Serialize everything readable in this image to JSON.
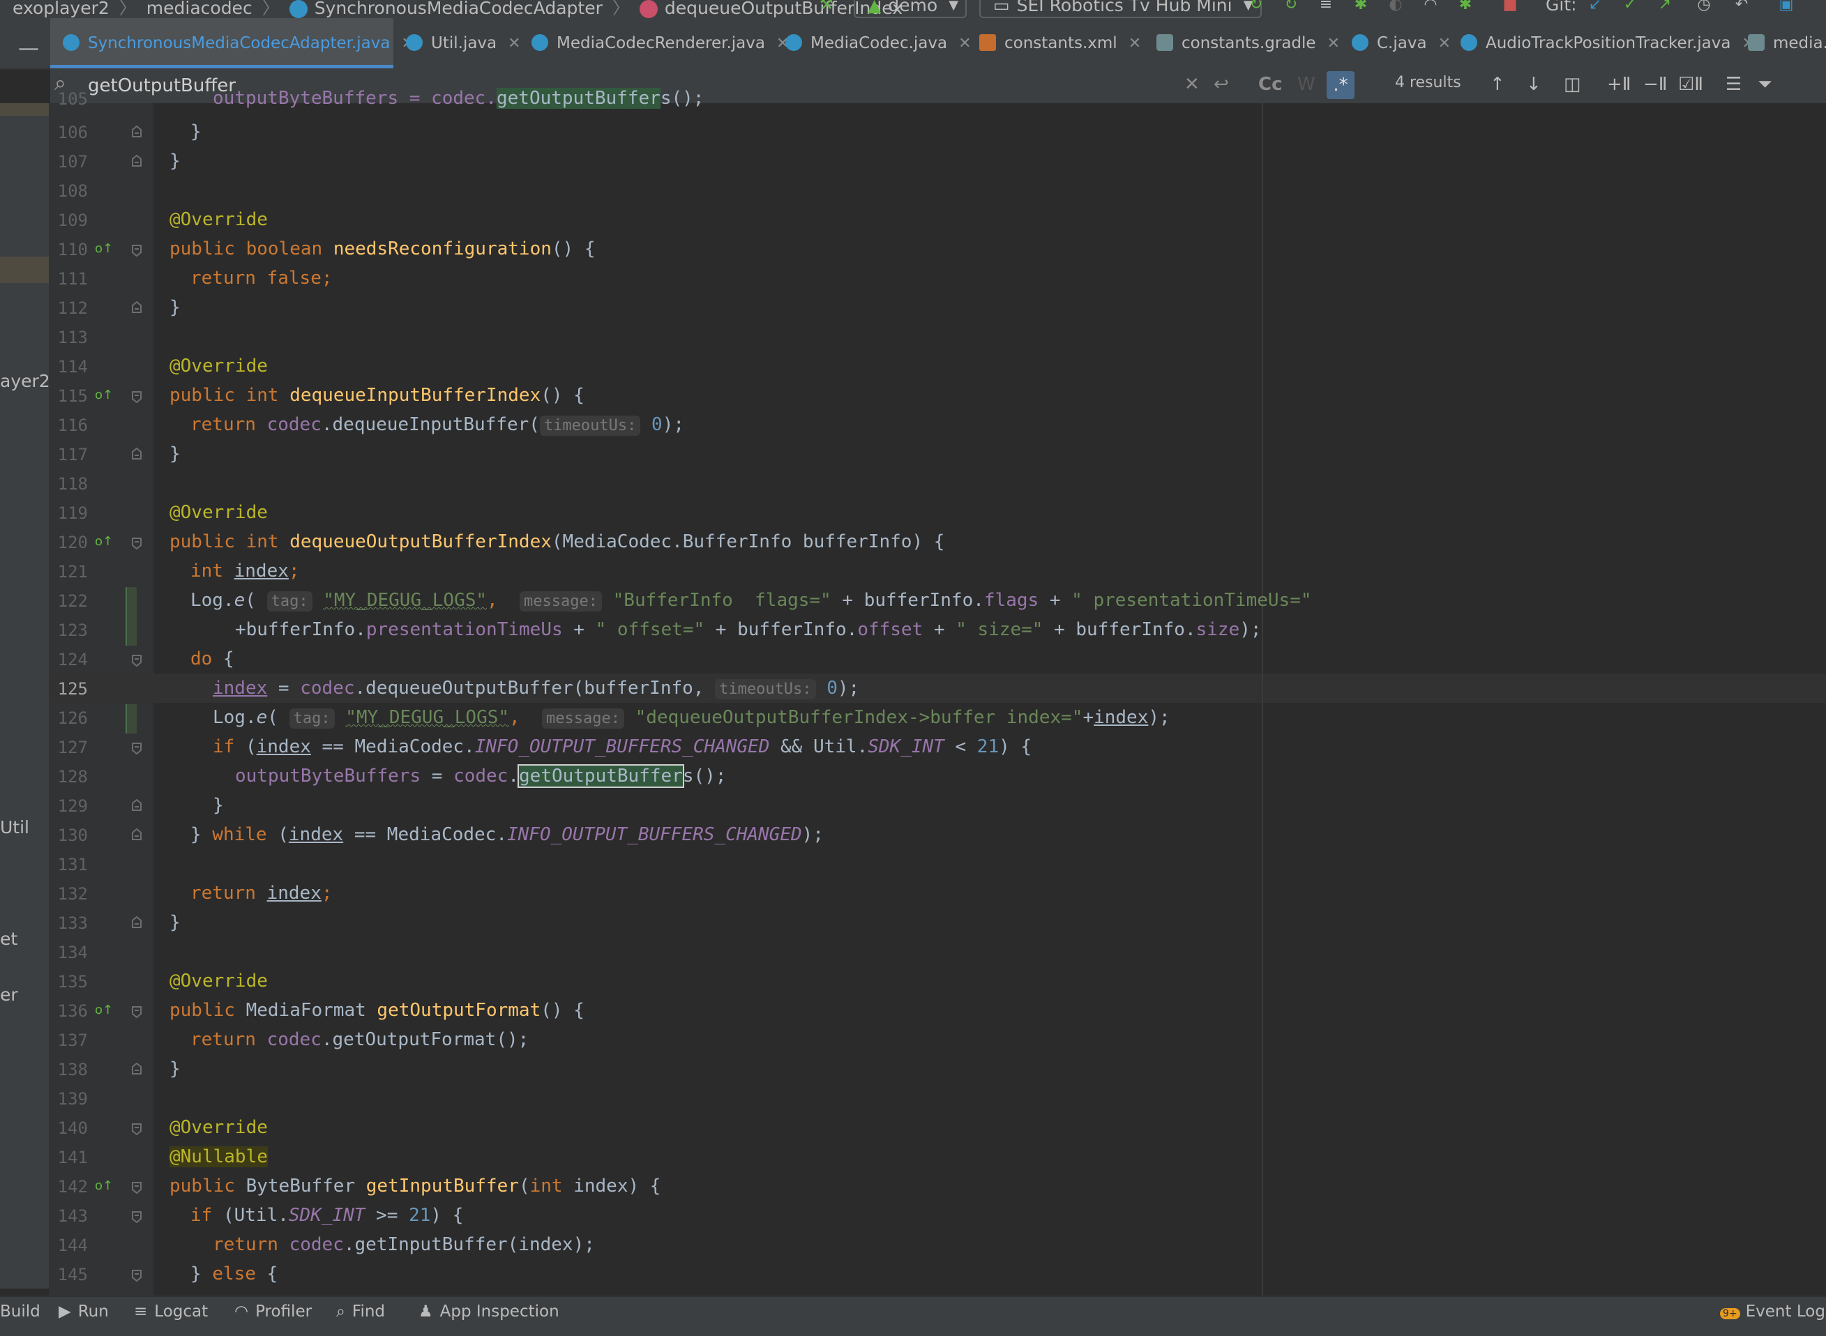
{
  "breadcrumbs": {
    "items": [
      "exoplayer2",
      "mediacodec",
      "SynchronousMediaCodecAdapter",
      "dequeueOutputBufferIndex"
    ],
    "separator": "〉"
  },
  "run_config": {
    "config": "demo",
    "device": "SEI Robotics Tv Hub Mini",
    "git_label": "Git:"
  },
  "tabs": [
    {
      "label": "SynchronousMediaCodecAdapter.java",
      "active": true
    },
    {
      "label": "Util.java"
    },
    {
      "label": "MediaCodecRenderer.java"
    },
    {
      "label": "MediaCodec.java"
    },
    {
      "label": "constants.xml"
    },
    {
      "label": "constants.gradle"
    },
    {
      "label": "C.java"
    },
    {
      "label": "AudioTrackPositionTracker.java"
    },
    {
      "label": "media.exo"
    }
  ],
  "search": {
    "value": "getOutputBuffer",
    "results": "4 results",
    "case_label": "Cc",
    "word_label": "W",
    "regex_label": ".*"
  },
  "project_strip": {
    "labels": [
      "ayer2",
      "Util",
      "et",
      "er"
    ]
  },
  "code": {
    "lines": {
      "l105": "105",
      "l106": "106",
      "l107": "107",
      "l108": "108",
      "l109": "109",
      "l110": "110",
      "l111": "111",
      "l112": "112",
      "l113": "113",
      "l114": "114",
      "l115": "115",
      "l116": "116",
      "l117": "117",
      "l118": "118",
      "l119": "119",
      "l120": "120",
      "l121": "121",
      "l122": "122",
      "l123": "123",
      "l124": "124",
      "l125": "125",
      "l126": "126",
      "l127": "127",
      "l128": "128",
      "l129": "129",
      "l130": "130",
      "l131": "131",
      "l132": "132",
      "l133": "133",
      "l134": "134",
      "l135": "135",
      "l136": "136",
      "l137": "137",
      "l138": "138",
      "l139": "139",
      "l140": "140",
      "l141": "141",
      "l142": "142",
      "l143": "143",
      "l144": "144",
      "l145": "145"
    },
    "text": {
      "override": "@Override",
      "nullable": "@Nullable",
      "public": "public",
      "int": "int",
      "boolean": "boolean",
      "return": "return",
      "false": "false",
      "if": "if",
      "do": "do",
      "while": "while",
      "else": "else",
      "codec": "codec",
      "index": "index",
      "zero": "0",
      "twentyone": "21",
      "outputByteBuffers": "outputByteBuffers",
      "bufferInfo": "bufferInfo",
      "flags": "flags",
      "presentationTimeUs": "presentationTimeUs",
      "offset": "offset",
      "size": "size",
      "INFO_OUTPUT_BUFFERS_CHANGED": "INFO_OUTPUT_BUFFERS_CHANGED",
      "SDK_INT": "SDK_INT",
      "e": "e",
      "hint_timeoutUs": "timeoutUs:",
      "hint_tag": "tag:",
      "hint_message": "message:",
      "getOutputBuffer": "getOutputBuffer",
      "l105_a": "outputByteBuffers = codec.",
      "l105_c": "s();",
      "l106": "}",
      "l107": "}",
      "l110_name": "needsReconfiguration",
      "l110_tail": "() {",
      "l111_tail": ";",
      "l112": "}",
      "l115_name": "dequeueInputBufferIndex",
      "l115_tail": "() {",
      "l116_call": ".dequeueInputBuffer(",
      "l116_tail": ");",
      "l117": "}",
      "l120_name": "dequeueOutputBufferIndex",
      "l120_tail": "(MediaCodec.BufferInfo bufferInfo) {",
      "l121_tail": ";",
      "l122_log": "Log.",
      "l122_paren": "( ",
      "l122_tagstr": "\"MY_DEGUG_LOGS\"",
      "l122_comma": ", ",
      "l122_msg": "\"BufferInfo  flags=\"",
      "l122_plus": " + ",
      "l122_dot": ".",
      "l122_str2": "\" presentationTimeUs=\"",
      "l123_plus": "+",
      "l123_str1": "\" offset=\"",
      "l123_str2": "\" size=\"",
      "l123_tail": ");",
      "l124_tail": " {",
      "l125_eq": " = ",
      "l125_call": ".dequeueOutputBuffer(bufferInfo, ",
      "l125_tail": ");",
      "l126_str": "\"dequeueOutputBufferIndex->buffer index=\"",
      "l126_plus": "+",
      "l126_tail": ");",
      "l127_open": " (",
      "l127_eq": " == MediaCodec.",
      "l127_and": " && Util.",
      "l127_lt": " < ",
      "l127_tail": ") {",
      "l128_a": " = ",
      "l128_b": ".",
      "l128_c": "s();",
      "l129": "}",
      "l130_a": "} ",
      "l130_b": " (",
      "l130_c": " == MediaCodec.",
      "l130_tail": ");",
      "l132_tail": ";",
      "l133": "}",
      "l136_type": "MediaFormat",
      "l136_name": "getOutputFormat",
      "l136_tail": "() {",
      "l137_call": ".getOutputFormat();",
      "l138": "}",
      "l142_type": "ByteBuffer",
      "l142_name": "getInputBuffer",
      "l142_tail": " index) {",
      "l142_paren": "(",
      "l143_a": " (Util.",
      "l143_b": " >= ",
      "l143_tail": ") {",
      "l144_call": ".getInputBuffer(index);",
      "l145_a": "} ",
      "l145_tail": " {"
    }
  },
  "bottom_bar": {
    "build": "Build",
    "run": "Run",
    "logcat": "Logcat",
    "profiler": "Profiler",
    "find": "Find",
    "app_inspection": "App Inspection",
    "event_log": "Event Log",
    "event_log_badge": "9+"
  }
}
